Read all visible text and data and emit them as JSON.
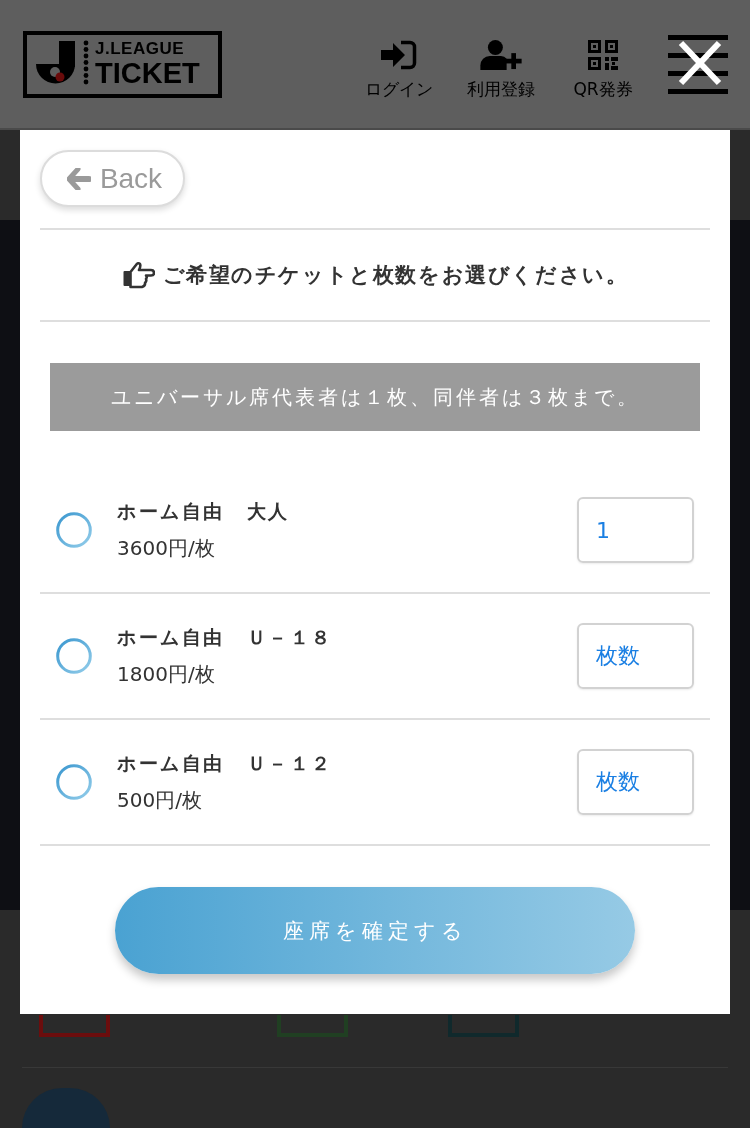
{
  "header": {
    "logo_top": "J.LEAGUE",
    "logo_bottom": "TICKET",
    "nav": [
      {
        "kind": "login",
        "label": "ログイン"
      },
      {
        "kind": "register",
        "label": "利用登録"
      },
      {
        "kind": "qr",
        "label": "QR発券"
      }
    ]
  },
  "legend": [
    {
      "color": "#6b0d0d"
    },
    {
      "color": "#203f22"
    },
    {
      "color": "#10292c"
    }
  ],
  "modal": {
    "back": "Back",
    "instruction": "ご希望のチケットと枚数をお選びください。",
    "notice": "ユニバーサル席代表者は１枚、同伴者は３枚まで。",
    "tickets": [
      {
        "name": "ホーム自由　大人",
        "price": "3600円/枚",
        "selected": false,
        "quantity": {
          "value": "1"
        }
      },
      {
        "name": "ホーム自由　Ｕ－１８",
        "price": "1800円/枚",
        "selected": false,
        "quantity": {
          "placeholder": "枚数"
        }
      },
      {
        "name": "ホーム自由　Ｕ－１２",
        "price": "500円/枚",
        "selected": false,
        "quantity": {
          "placeholder": "枚数"
        }
      }
    ],
    "confirm": "座席を確定する"
  }
}
